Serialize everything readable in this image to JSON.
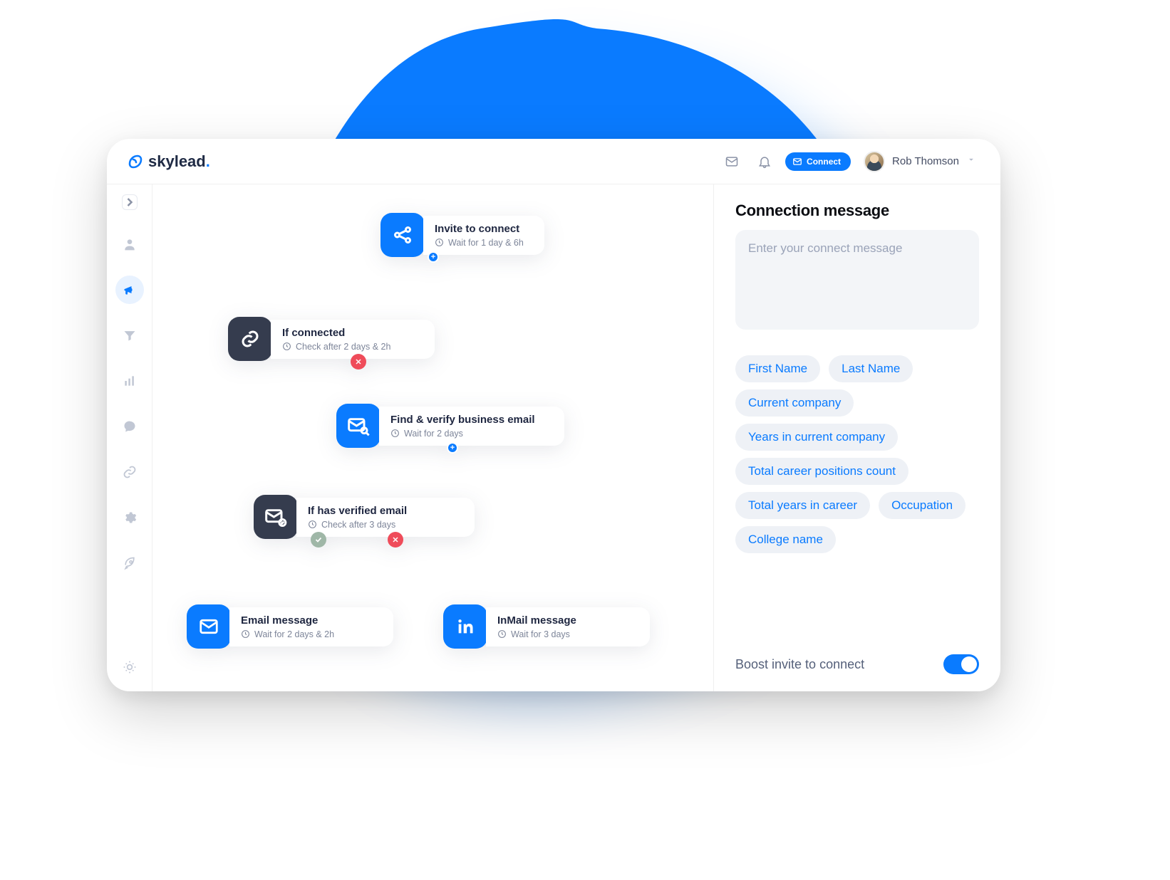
{
  "brand": {
    "name": "skylead"
  },
  "header": {
    "connect_label": "Connect",
    "user_name": "Rob Thomson"
  },
  "sidebar": {
    "items": [
      {
        "id": "profile-icon"
      },
      {
        "id": "megaphone-icon",
        "active": true
      },
      {
        "id": "funnel-icon"
      },
      {
        "id": "stats-icon"
      },
      {
        "id": "chat-icon"
      },
      {
        "id": "link2-icon"
      },
      {
        "id": "gear-icon"
      },
      {
        "id": "rocket-icon"
      }
    ],
    "bottom": {
      "id": "brightness-icon"
    }
  },
  "flow": {
    "nodes": {
      "invite": {
        "title": "Invite to connect",
        "sub": "Wait for 1 day & 6h"
      },
      "if_connected": {
        "title": "If connected",
        "sub": "Check after 2 days & 2h"
      },
      "find_email": {
        "title": "Find & verify business email",
        "sub": "Wait for 2 days"
      },
      "if_verified": {
        "title": "If has verified email",
        "sub": "Check after  3 days"
      },
      "email_msg": {
        "title": "Email message",
        "sub": "Wait for 2 days & 2h"
      },
      "inmail_msg": {
        "title": "InMail message",
        "sub": "Wait for 3 days"
      }
    }
  },
  "panel": {
    "heading": "Connection message",
    "placeholder": "Enter your connect message",
    "tags": [
      "First Name",
      "Last Name",
      "Current company",
      "Years in current company",
      "Total career positions count",
      "Total years in career",
      "Occupation",
      "College name"
    ],
    "boost_label": "Boost invite to connect",
    "boost_on": true
  }
}
